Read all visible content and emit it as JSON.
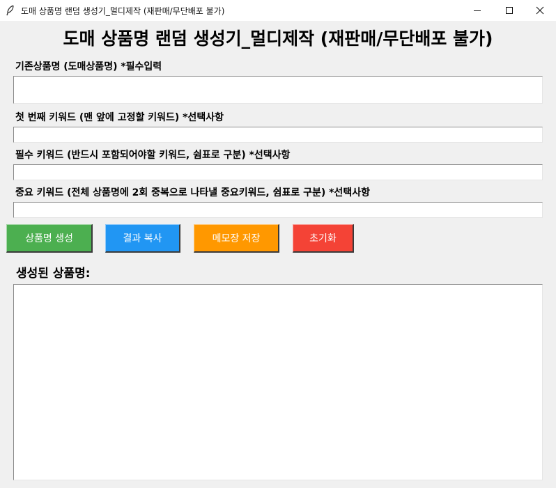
{
  "window": {
    "title": "도매 상품명 랜덤 생성기_멀디제작 (재판매/무단배포 불가)",
    "icon": "feather-icon",
    "controls": [
      "minimize-icon",
      "maximize-icon",
      "close-icon"
    ]
  },
  "main": {
    "heading": "도매 상품명 랜덤 생성기_멀디제작 (재판매/무단배포 불가)"
  },
  "fields": [
    {
      "label": "기존상품명 (도매상품명) *필수입력",
      "value": ""
    },
    {
      "label": "첫 번째 키워드 (맨 앞에 고정할 키워드) *선택사항",
      "value": ""
    },
    {
      "label": "필수 키워드 (반드시 포함되어야할 키워드, 쉼표로 구분) *선택사항",
      "value": ""
    },
    {
      "label": "중요 키워드 (전체 상품명에 2회 중복으로 나타낼 중요키워드, 쉼표로 구분) *선택사항",
      "value": ""
    }
  ],
  "buttons": {
    "generate": {
      "label": "상품명 생성",
      "color": "#4caf50"
    },
    "copy": {
      "label": "결과 복사",
      "color": "#2196f3"
    },
    "save": {
      "label": "메모장 저장",
      "color": "#ff9800"
    },
    "reset": {
      "label": "초기화",
      "color": "#f44336"
    }
  },
  "result": {
    "label": "생성된 상품명:",
    "value": ""
  }
}
